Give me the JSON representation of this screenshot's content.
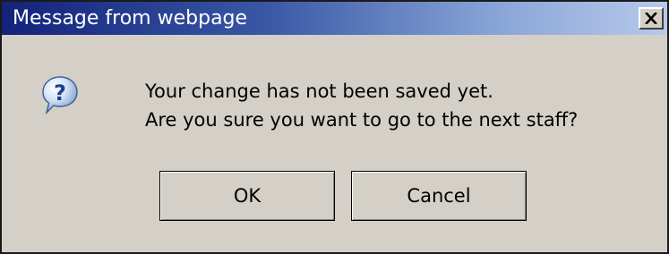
{
  "window": {
    "title": "Message from webpage",
    "close_icon": "close-x-icon"
  },
  "dialog": {
    "icon": "question-icon",
    "message_lines": [
      "Your change has not been saved yet.",
      "Are you sure you want to go to the next staff?"
    ]
  },
  "buttons": {
    "ok_label": "OK",
    "cancel_label": "Cancel"
  },
  "colors": {
    "titlebar_start": "#12237a",
    "titlebar_end": "#b7c9ea",
    "dialog_background": "#d4d0c8"
  }
}
